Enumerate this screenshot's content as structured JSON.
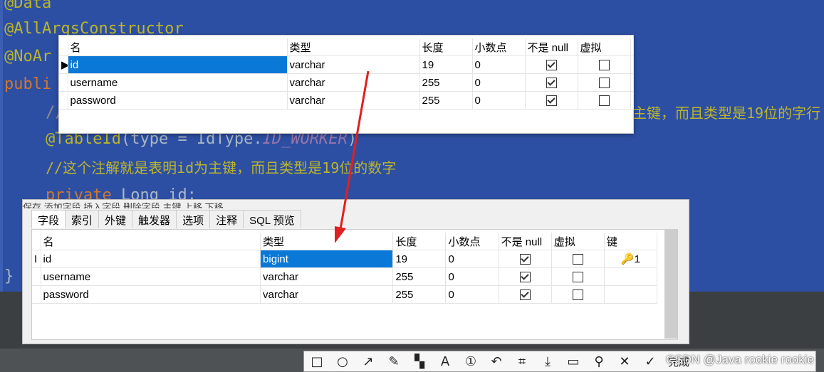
{
  "code": {
    "line1": "@Data",
    "line2": "@AllArgsConstructor",
    "line3": "@NoAr",
    "line4": "publi",
    "line5_prefix": "//",
    "line5_suffix": "主键，而且类型是19位的字行",
    "line6_ann": "@TableId",
    "line6_rest": "(type = IdType.",
    "line6_enum": "ID_WORKER",
    "line6_close": ")",
    "line7": "//这个注解就是表明id为主键，而且类型是19位的数字",
    "line8_kw": "private ",
    "line8_rest": "Long id;",
    "line9": "}"
  },
  "dialog1": {
    "headers": [
      "名",
      "类型",
      "长度",
      "小数点",
      "不是 null",
      "虚拟"
    ],
    "rows": [
      {
        "name": "id",
        "type": "varchar",
        "length": "19",
        "decimals": "0",
        "not_null": true,
        "virtual": false
      },
      {
        "name": "username",
        "type": "varchar",
        "length": "255",
        "decimals": "0",
        "not_null": true,
        "virtual": false
      },
      {
        "name": "password",
        "type": "varchar",
        "length": "255",
        "decimals": "0",
        "not_null": true,
        "virtual": false
      }
    ]
  },
  "dialog2": {
    "toolbar": "保存  添加字段  插入字段  删除字段  主键  上移  下移",
    "tabs": [
      "字段",
      "索引",
      "外键",
      "触发器",
      "选项",
      "注释",
      "SQL 预览"
    ],
    "headers": [
      "名",
      "类型",
      "长度",
      "小数点",
      "不是 null",
      "虚拟",
      "键"
    ],
    "rows": [
      {
        "name": "id",
        "type": "bigint",
        "length": "19",
        "decimals": "0",
        "not_null": true,
        "virtual": false,
        "key": "1"
      },
      {
        "name": "username",
        "type": "varchar",
        "length": "255",
        "decimals": "0",
        "not_null": true,
        "virtual": false,
        "key": ""
      },
      {
        "name": "password",
        "type": "varchar",
        "length": "255",
        "decimals": "0",
        "not_null": true,
        "virtual": false,
        "key": ""
      }
    ]
  },
  "snip_toolbar": {
    "icons": [
      "rectangle-icon",
      "circle-icon",
      "arrow-icon",
      "pen-icon",
      "mosaic-icon",
      "text-icon",
      "number-icon",
      "undo-icon",
      "ocr-icon",
      "download-icon",
      "save-icon",
      "pin-icon",
      "close-icon",
      "done-icon"
    ],
    "done_label": "完成"
  },
  "watermark": "CSDN @Java rookie rookie",
  "colors": {
    "editor_bg": "#2d4fa3",
    "selection": "#0a78d7",
    "arrow": "#e02020"
  }
}
